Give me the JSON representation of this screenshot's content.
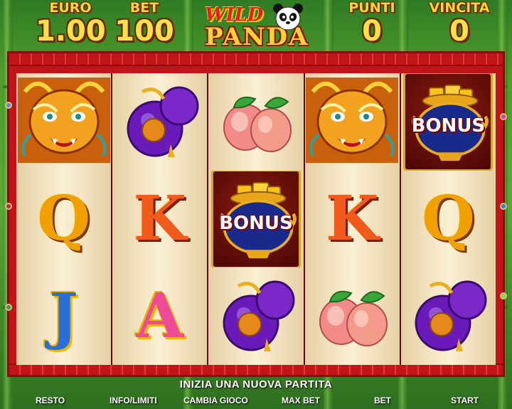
{
  "stats": {
    "euro": {
      "label": "EURO",
      "value": "1.00"
    },
    "bet": {
      "label": "BET",
      "value": "100"
    },
    "punti": {
      "label": "PUNTI",
      "value": "0"
    },
    "vincita": {
      "label": "VINCITA",
      "value": "0"
    }
  },
  "logo": {
    "line1": "WILD",
    "line2": "PANDA"
  },
  "reels": [
    [
      "dragon",
      "Q",
      "J"
    ],
    [
      "purple-gourd",
      "K",
      "A"
    ],
    [
      "peaches",
      "bonus",
      "purple-gourd"
    ],
    [
      "dragon",
      "K",
      "peaches"
    ],
    [
      "bonus",
      "Q",
      "purple-gourd"
    ]
  ],
  "bonus_text": "BONUS",
  "message": "INIZIA UNA NUOVA PARTITA",
  "buttons": {
    "resto": "RESTO",
    "info": "INFO/LIMITI",
    "cambia": "CAMBIA GIOCO",
    "maxbet": "MAX BET",
    "bet": "BET",
    "start": "START"
  },
  "colors": {
    "frame": "#c2151a",
    "gold": "#ffd23a",
    "reel_bg": "#fbf0d5"
  }
}
